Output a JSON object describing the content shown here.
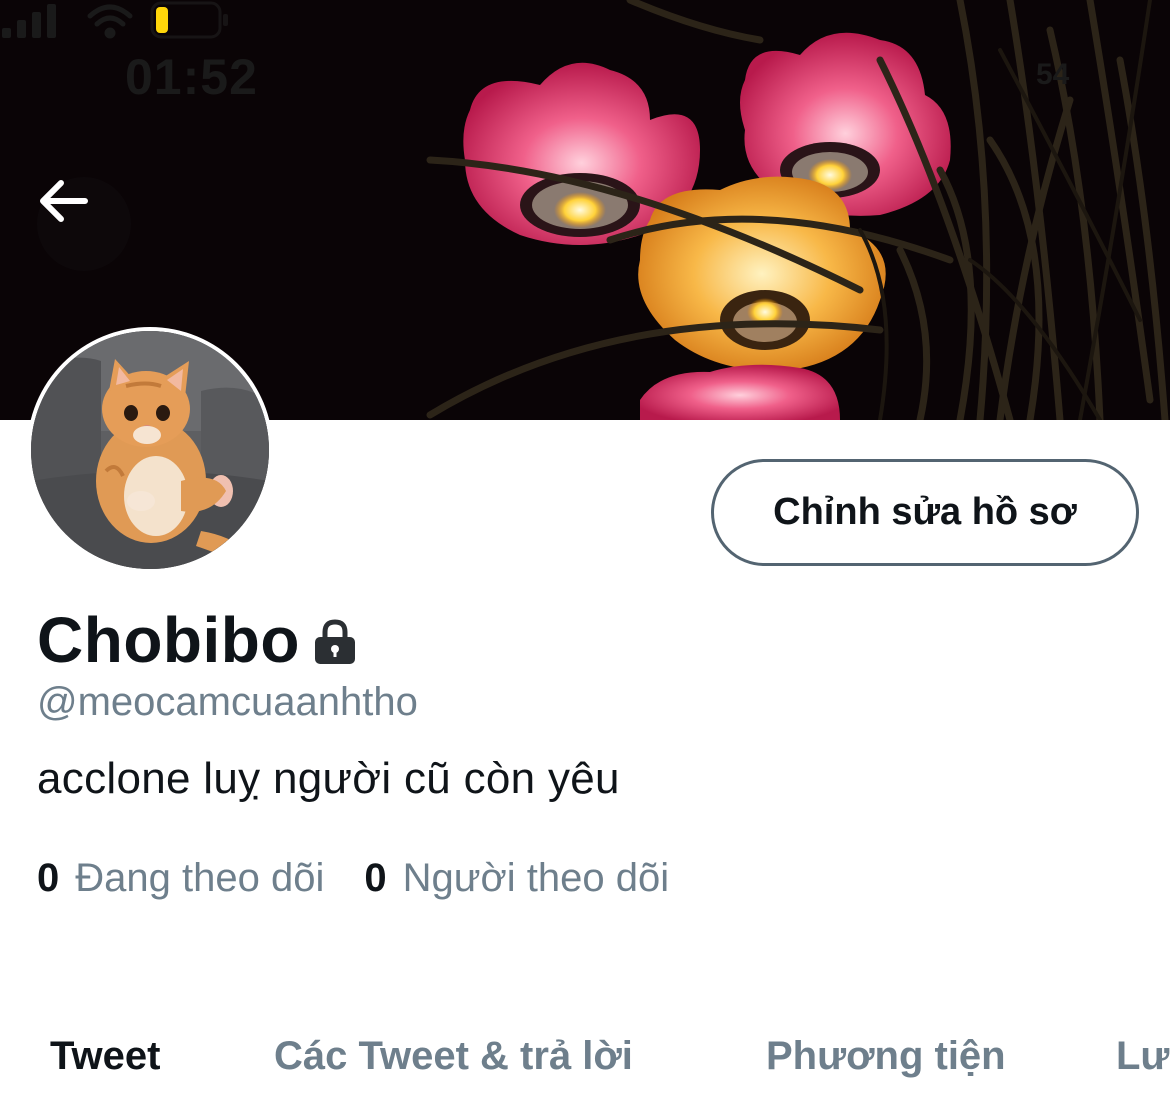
{
  "status_bar": {
    "time": "01:52",
    "battery_level": "54"
  },
  "header": {
    "back_icon": "arrow-left-icon"
  },
  "profile": {
    "edit_button_label": "Chỉnh sửa hồ sơ",
    "display_name": "Chobibo",
    "protected_icon": "lock-icon",
    "handle": "@meocamcuaanhtho",
    "bio": "acclone luỵ người cũ còn yêu",
    "following_count": "0",
    "following_label": "Đang theo dõi",
    "followers_count": "0",
    "followers_label": "Người theo dõi"
  },
  "tabs": [
    {
      "label": "Tweet",
      "active": true
    },
    {
      "label": "Các Tweet & trả lời",
      "active": false
    },
    {
      "label": "Phương tiện",
      "active": false
    },
    {
      "label": "Lượt thích",
      "active": false
    }
  ],
  "colors": {
    "text_primary": "#0f1419",
    "text_secondary": "#6e7f8c",
    "border": "#536471",
    "battery_yellow": "#ffd60a"
  }
}
